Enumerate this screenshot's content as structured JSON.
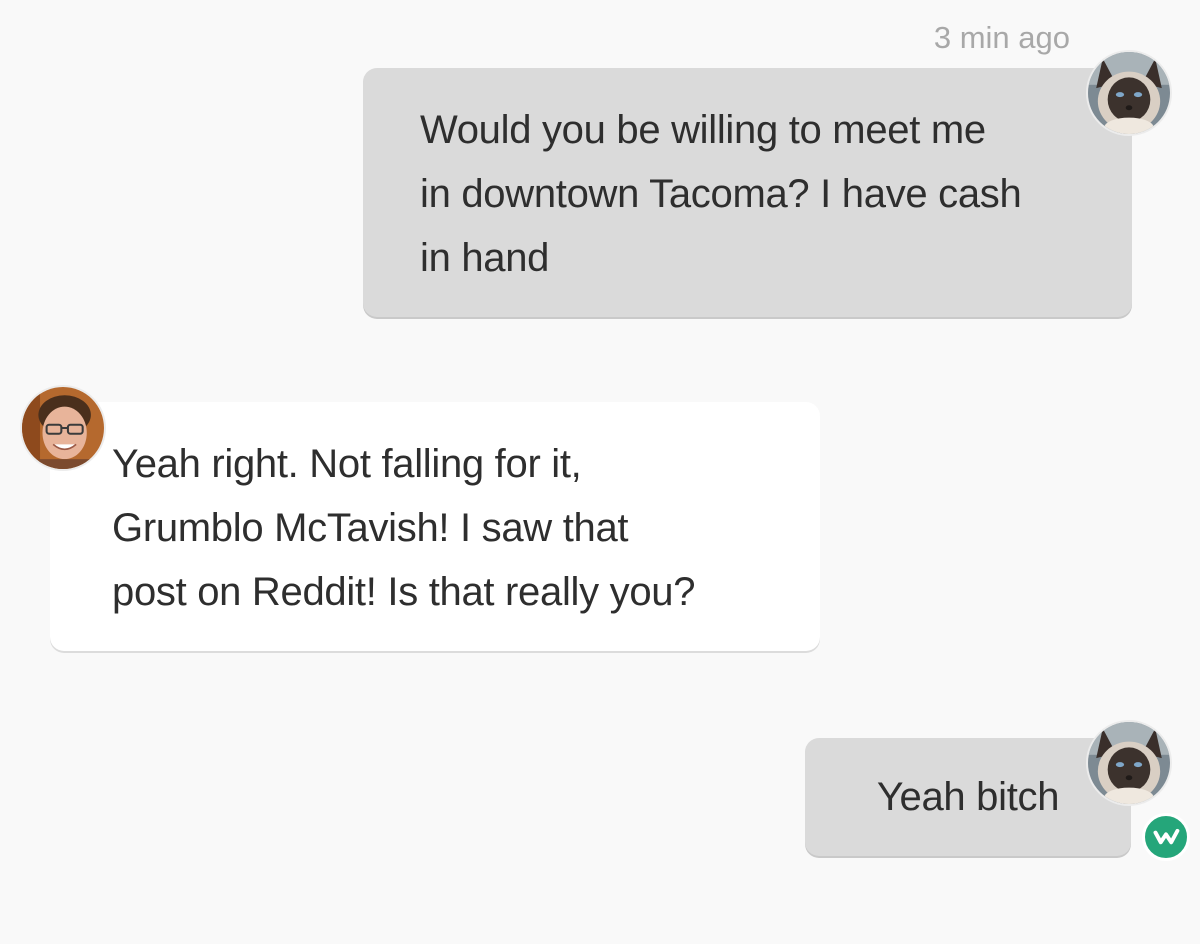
{
  "conversation": {
    "timestamp": "3 min ago",
    "messages": [
      {
        "sender": "self",
        "text": "Would you be willing to meet me\nin downtown Tacoma? I have cash\nin hand",
        "avatar_icon": "siamese-cat-avatar"
      },
      {
        "sender": "other",
        "text": "Yeah right. Not falling for it,\nGrumblo McTavish! I saw that\npost on Reddit! Is that really you?",
        "avatar_icon": "man-with-glasses-avatar"
      },
      {
        "sender": "self",
        "text": "Yeah bitch",
        "avatar_icon": "siamese-cat-avatar",
        "status_badge_icon": "app-logo-w-badge"
      }
    ]
  },
  "colors": {
    "background": "#f9f9f9",
    "outgoing_bubble": "#dadada",
    "incoming_bubble": "#ffffff",
    "text": "#2e2e2e",
    "timestamp": "#a8a8a8",
    "badge": "#25a67a"
  }
}
